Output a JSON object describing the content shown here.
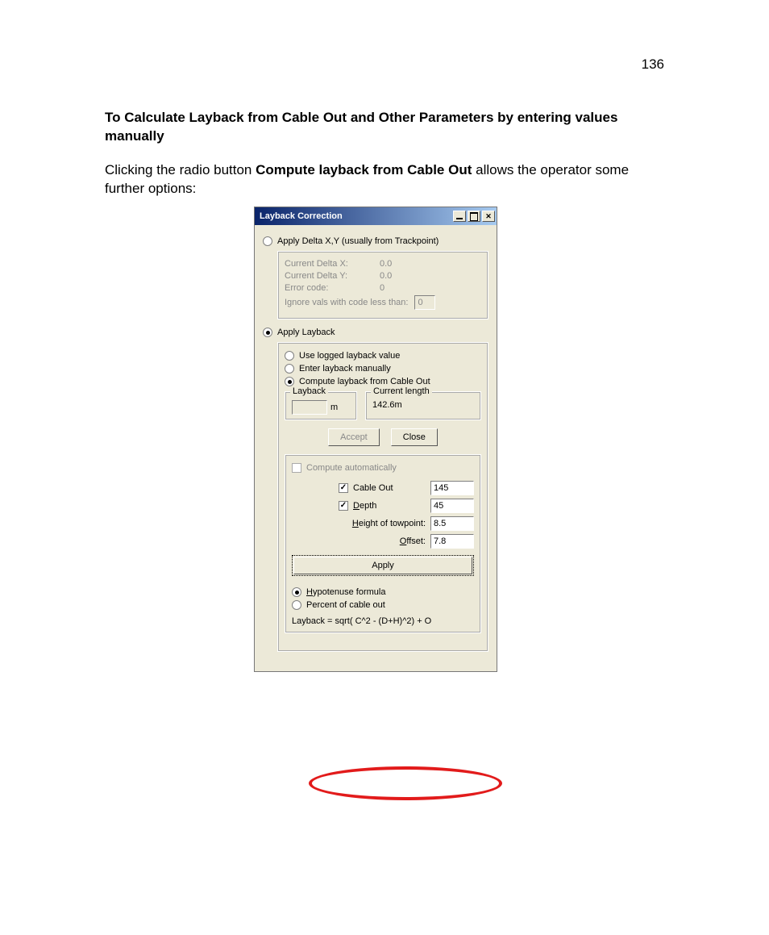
{
  "page_number": "136",
  "heading": "To Calculate Layback from Cable Out and Other Parameters by entering values manually",
  "para_prefix": "Clicking the radio button ",
  "para_bold": "Compute layback from Cable Out",
  "para_suffix": " allows the operator some further options:",
  "dialog": {
    "title": "Layback Correction",
    "radio_delta": "Apply Delta X,Y (usually from Trackpoint)",
    "delta_group": {
      "cur_dx_label": "Current Delta X:",
      "cur_dx_val": "0.0",
      "cur_dy_label": "Current Delta Y:",
      "cur_dy_val": "0.0",
      "err_label": "Error code:",
      "err_val": "0",
      "ignore_label": "Ignore vals with code less than:",
      "ignore_val": "0"
    },
    "radio_layback": "Apply Layback",
    "layback_sub": {
      "use_logged": "Use logged layback value",
      "enter_manual": "Enter layback manually",
      "compute_cable": "Compute layback from Cable Out"
    },
    "layback_fs_label": "Layback",
    "layback_unit": "m",
    "curlen_fs_label": "Current length",
    "curlen_value": "142.6m",
    "accept_btn": "Accept",
    "close_btn": "Close",
    "compute_auto": "Compute automatically",
    "cable_out_label": "Cable Out",
    "cable_out_val": "145",
    "depth_label_pre": "D",
    "depth_label_post": "epth",
    "depth_val": "45",
    "height_label_pre": "H",
    "height_label_post": "eight of towpoint:",
    "height_val": "8.5",
    "offset_label_pre": "O",
    "offset_label_post": "ffset:",
    "offset_val": "7.8",
    "apply_btn": "Apply",
    "hypo_label_pre": "H",
    "hypo_label_post": "ypotenuse formula",
    "percent_label": "Percent of cable out",
    "formula": "Layback = sqrt( C^2 - (D+H)^2) + O"
  }
}
